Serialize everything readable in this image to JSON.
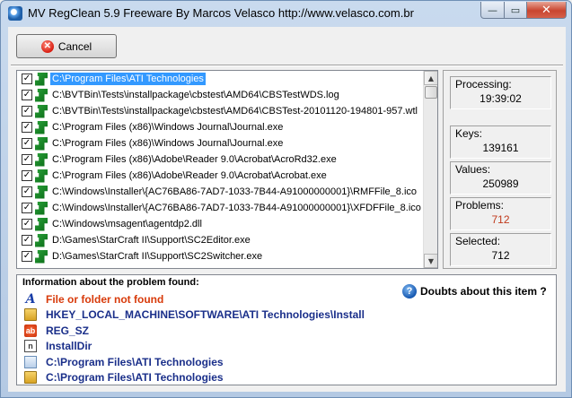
{
  "window": {
    "title": "MV RegClean 5.9 Freeware    By Marcos Velasco    http://www.velasco.com.br",
    "min_symbol": "—",
    "max_symbol": "▭",
    "close_symbol": "✕"
  },
  "toolbar": {
    "cancel_label": "Cancel",
    "cancel_symbol": "✕"
  },
  "list": {
    "check_symbol": "✓",
    "items": [
      {
        "path": "C:\\Program Files\\ATI Technologies",
        "checked": true,
        "selected": true
      },
      {
        "path": "C:\\BVTBin\\Tests\\installpackage\\cbstest\\AMD64\\CBSTestWDS.log",
        "checked": true
      },
      {
        "path": "C:\\BVTBin\\Tests\\installpackage\\cbstest\\AMD64\\CBSTest-20101120-194801-957.wtl",
        "checked": true
      },
      {
        "path": "C:\\Program Files (x86)\\Windows Journal\\Journal.exe",
        "checked": true
      },
      {
        "path": "C:\\Program Files (x86)\\Windows Journal\\Journal.exe",
        "checked": true
      },
      {
        "path": "C:\\Program Files (x86)\\Adobe\\Reader 9.0\\Acrobat\\AcroRd32.exe",
        "checked": true
      },
      {
        "path": "C:\\Program Files (x86)\\Adobe\\Reader 9.0\\Acrobat\\Acrobat.exe",
        "checked": true
      },
      {
        "path": "C:\\Windows\\Installer\\{AC76BA86-7AD7-1033-7B44-A91000000001}\\RMFFile_8.ico",
        "checked": true
      },
      {
        "path": "C:\\Windows\\Installer\\{AC76BA86-7AD7-1033-7B44-A91000000001}\\XFDFFile_8.ico",
        "checked": true
      },
      {
        "path": "C:\\Windows\\msagent\\agentdp2.dll",
        "checked": true
      },
      {
        "path": "D:\\Games\\StarCraft II\\Support\\SC2Editor.exe",
        "checked": true
      },
      {
        "path": "D:\\Games\\StarCraft II\\Support\\SC2Switcher.exe",
        "checked": true
      }
    ]
  },
  "stats": {
    "processing": {
      "label": "Processing:",
      "value": "19:39:02"
    },
    "keys": {
      "label": "Keys:",
      "value": "139161"
    },
    "values": {
      "label": "Values:",
      "value": "250989"
    },
    "problems": {
      "label": "Problems:",
      "value": "712",
      "color": "#c0391b"
    },
    "selected": {
      "label": "Selected:",
      "value": "712"
    }
  },
  "info": {
    "title": "Information about the problem found:",
    "doubts_label": "Doubts about this item ?",
    "rows": [
      {
        "icon": "font-icon",
        "glyph": "A",
        "text": "File or folder not found",
        "color": "#d83a0a"
      },
      {
        "icon": "registry-folder-icon",
        "glyph": "",
        "text": "HKEY_LOCAL_MACHINE\\SOFTWARE\\ATI Technologies\\Install",
        "color": "#1a2f8a"
      },
      {
        "icon": "registry-string-icon",
        "glyph": "ab",
        "text": "REG_SZ",
        "color": "#1a2f8a"
      },
      {
        "icon": "value-name-icon",
        "glyph": "n",
        "text": "InstallDir",
        "color": "#1a2f8a"
      },
      {
        "icon": "document-icon",
        "glyph": "",
        "text": "C:\\Program Files\\ATI Technologies",
        "color": "#1a2f8a"
      },
      {
        "icon": "folder-icon",
        "glyph": "",
        "text": "C:\\Program Files\\ATI Technologies",
        "color": "#1a2f8a"
      }
    ]
  }
}
